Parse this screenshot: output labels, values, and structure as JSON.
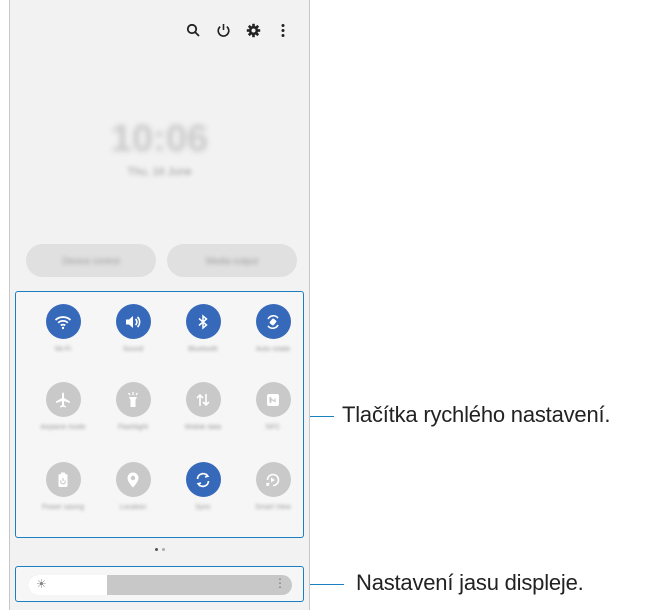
{
  "top_icons": [
    "search-icon",
    "power-icon",
    "gear-icon",
    "more-vertical-icon"
  ],
  "clock": "10:06",
  "date": "Thu, 16 June",
  "pills": [
    "Device control",
    "Media output"
  ],
  "tiles": [
    {
      "name": "wifi",
      "label": "Wi-Fi",
      "on": true
    },
    {
      "name": "sound",
      "label": "Sound",
      "on": true
    },
    {
      "name": "bluetooth",
      "label": "Bluetooth",
      "on": true
    },
    {
      "name": "auto-rotate",
      "label": "Auto rotate",
      "on": true
    },
    {
      "name": "airplane",
      "label": "Airplane mode",
      "on": false
    },
    {
      "name": "flashlight",
      "label": "Flashlight",
      "on": false
    },
    {
      "name": "mobile-data",
      "label": "Mobile data",
      "on": false
    },
    {
      "name": "nfc",
      "label": "NFC",
      "on": false
    },
    {
      "name": "power-saving",
      "label": "Power saving",
      "on": false
    },
    {
      "name": "location",
      "label": "Location",
      "on": false
    },
    {
      "name": "sync",
      "label": "Sync",
      "on": true
    },
    {
      "name": "smart-view",
      "label": "Smart View",
      "on": false
    }
  ],
  "brightness": {
    "level": 0.3
  },
  "callouts": {
    "quick_settings": "Tlačítka rychlého nastavení.",
    "brightness": "Nastavení jasu displeje."
  },
  "colors": {
    "accent": "#3669ba",
    "callout": "#1a7fc1"
  }
}
